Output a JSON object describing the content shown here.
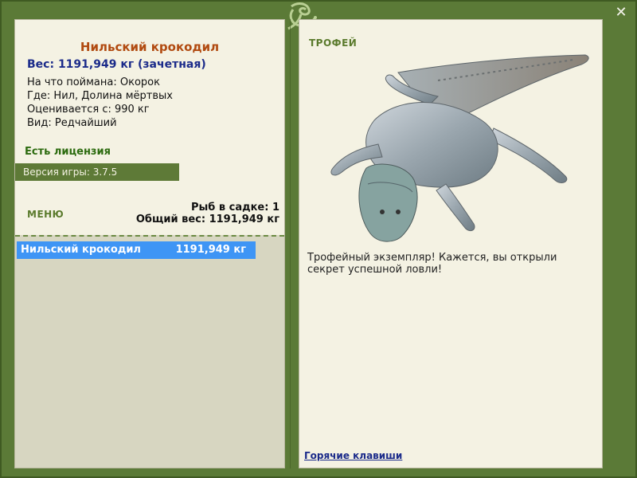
{
  "window": {
    "close_icon": "close-icon"
  },
  "fish": {
    "name": "Нильский крокодил",
    "weight_line": "Вес: 1191,949 кг (зачетная)",
    "bait": "На что поймана: Окорок",
    "location": "Где: Нил, Долина мёртвых",
    "valued_from": "Оценивается с: 990 кг",
    "kind": "Вид: Редчайший"
  },
  "license": "Есть лицензия",
  "version": "Версия игры: 3.7.5",
  "menu_label": "МЕНЮ",
  "keepnet": {
    "fish_count": "Рыб в садке: 1",
    "total_weight": "Общий вес: 1191,949 кг",
    "items": [
      {
        "name": "Нильский крокодил",
        "weight": "1191,949 кг"
      }
    ]
  },
  "trophy": {
    "label": "ТРОФЕЙ",
    "text": "Трофейный экземпляр! Кажется, вы открыли секрет успешной ловли!"
  },
  "hotkeys": "Горячие клавиши",
  "colors": {
    "frame": "#5b7a37",
    "panel": "#f4f2e3",
    "selected": "#3e95f5",
    "title": "#b14a10",
    "weight": "#1b2b8a"
  }
}
